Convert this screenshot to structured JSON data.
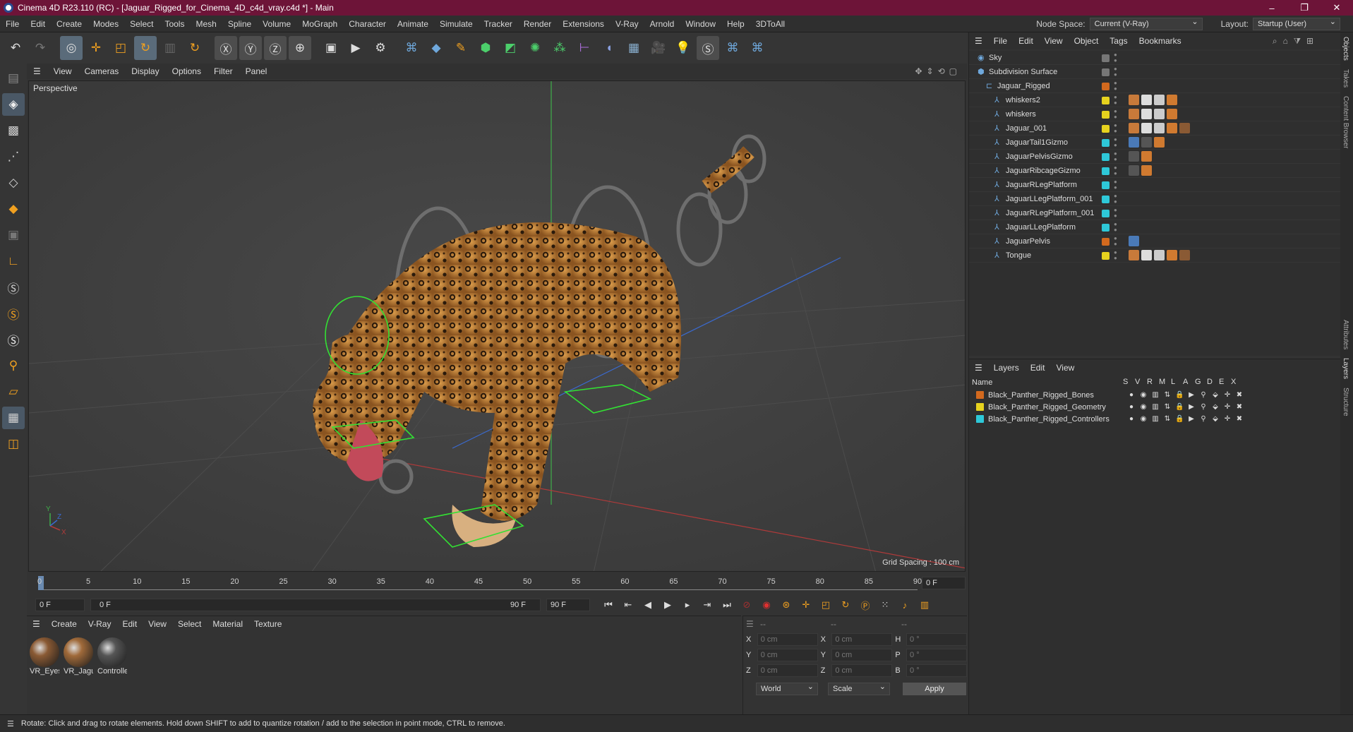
{
  "title_bar": {
    "title": "Cinema 4D R23.110 (RC) - [Jaguar_Rigged_for_Cinema_4D_c4d_vray.c4d *] - Main",
    "buttons": [
      "–",
      "❐",
      "✕"
    ]
  },
  "menu": {
    "items": [
      "File",
      "Edit",
      "Create",
      "Modes",
      "Select",
      "Tools",
      "Mesh",
      "Spline",
      "Volume",
      "MoGraph",
      "Character",
      "Animate",
      "Simulate",
      "Tracker",
      "Render",
      "Extensions",
      "V-Ray",
      "Arnold",
      "Window",
      "Help",
      "3DToAll"
    ],
    "node_space_label": "Node Space:",
    "node_space_value": "Current (V-Ray)",
    "layout_label": "Layout:",
    "layout_value": "Startup (User)"
  },
  "viewport": {
    "menu": [
      "View",
      "Cameras",
      "Display",
      "Options",
      "Filter",
      "Panel"
    ],
    "label": "Perspective",
    "grid_spacing": "Grid Spacing : 100 cm",
    "axis_labels": [
      "Y",
      "Z",
      "X"
    ]
  },
  "timeline": {
    "ticks": [
      "0",
      "5",
      "10",
      "15",
      "20",
      "25",
      "30",
      "35",
      "40",
      "45",
      "50",
      "55",
      "60",
      "65",
      "70",
      "75",
      "80",
      "85",
      "90"
    ],
    "current": "0 F",
    "start": "0 F",
    "range_start": "0 F",
    "range_end": "90 F",
    "end": "90 F"
  },
  "materials": {
    "menu": [
      "Create",
      "V-Ray",
      "Edit",
      "View",
      "Select",
      "Material",
      "Texture"
    ],
    "items": [
      {
        "label": "VR_Eyes",
        "color": "#8a5a34"
      },
      {
        "label": "VR_Jagu",
        "color": "#a06a3a"
      },
      {
        "label": "Controlle",
        "color": "#555555"
      }
    ]
  },
  "coords": {
    "headers": [
      "--",
      "--",
      "--"
    ],
    "rows": [
      {
        "a": "X",
        "av": "0 cm",
        "b": "X",
        "bv": "0 cm",
        "c": "H",
        "cv": "0 °"
      },
      {
        "a": "Y",
        "av": "0 cm",
        "b": "Y",
        "bv": "0 cm",
        "c": "P",
        "cv": "0 °"
      },
      {
        "a": "Z",
        "av": "0 cm",
        "b": "Z",
        "bv": "0 cm",
        "c": "B",
        "cv": "0 °"
      }
    ],
    "space": "World",
    "mode": "Scale",
    "apply": "Apply"
  },
  "object_manager": {
    "menu": [
      "File",
      "Edit",
      "View",
      "Object",
      "Tags",
      "Bookmarks"
    ],
    "objects": [
      {
        "name": "Sky",
        "indent": 0,
        "color": "",
        "tags": []
      },
      {
        "name": "Subdivision Surface",
        "indent": 0,
        "color": "",
        "tags": []
      },
      {
        "name": "Jaguar_Rigged",
        "indent": 1,
        "color": "#d2691e",
        "tags": []
      },
      {
        "name": "whiskers2",
        "indent": 2,
        "color": "#e6d21e",
        "tags": [
          "#c87a3a",
          "#dddddd",
          "#cccccc",
          "#d07a30"
        ]
      },
      {
        "name": "whiskers",
        "indent": 2,
        "color": "#e6d21e",
        "tags": [
          "#c87a3a",
          "#dddddd",
          "#cccccc",
          "#d07a30"
        ]
      },
      {
        "name": "Jaguar_001",
        "indent": 2,
        "color": "#e6d21e",
        "tags": [
          "#c87a3a",
          "#dddddd",
          "#cccccc",
          "#d07a30",
          "#8a5a34"
        ]
      },
      {
        "name": "JaguarTail1Gizmo",
        "indent": 2,
        "color": "#2ec8d8",
        "tags": [
          "#4a7ab8",
          "#555555",
          "#d07a30"
        ]
      },
      {
        "name": "JaguarPelvisGizmo",
        "indent": 2,
        "color": "#2ec8d8",
        "tags": [
          "#555555",
          "#d07a30"
        ]
      },
      {
        "name": "JaguarRibcageGizmo",
        "indent": 2,
        "color": "#2ec8d8",
        "tags": [
          "#555555",
          "#d07a30"
        ]
      },
      {
        "name": "JaguarRLegPlatform",
        "indent": 2,
        "color": "#2ec8d8",
        "tags": []
      },
      {
        "name": "JaguarLLegPlatform_001",
        "indent": 2,
        "color": "#2ec8d8",
        "tags": []
      },
      {
        "name": "JaguarRLegPlatform_001",
        "indent": 2,
        "color": "#2ec8d8",
        "tags": []
      },
      {
        "name": "JaguarLLegPlatform",
        "indent": 2,
        "color": "#2ec8d8",
        "tags": []
      },
      {
        "name": "JaguarPelvis",
        "indent": 2,
        "color": "#d2691e",
        "tags": [
          "#4a7ab8"
        ]
      },
      {
        "name": "Tongue",
        "indent": 2,
        "color": "#e6d21e",
        "tags": [
          "#c87a3a",
          "#dddddd",
          "#cccccc",
          "#d07a30",
          "#8a5a34"
        ]
      }
    ]
  },
  "layer_manager": {
    "menu": [
      "Layers",
      "Edit",
      "View"
    ],
    "columns": [
      "Name",
      "S",
      "V",
      "R",
      "M",
      "L",
      "A",
      "G",
      "D",
      "E",
      "X"
    ],
    "layers": [
      {
        "name": "Black_Panther_Rigged_Bones",
        "color": "#d2691e"
      },
      {
        "name": "Black_Panther_Rigged_Geometry",
        "color": "#e6d21e"
      },
      {
        "name": "Black_Panther_Rigged_Controllers",
        "color": "#2ec8d8"
      }
    ]
  },
  "side_tabs": [
    "Objects",
    "Takes",
    "Content Browser",
    "Attributes",
    "Layers",
    "Structure"
  ],
  "status": "Rotate: Click and drag to rotate elements. Hold down SHIFT to add to quantize rotation / add to the selection in point mode, CTRL to remove."
}
